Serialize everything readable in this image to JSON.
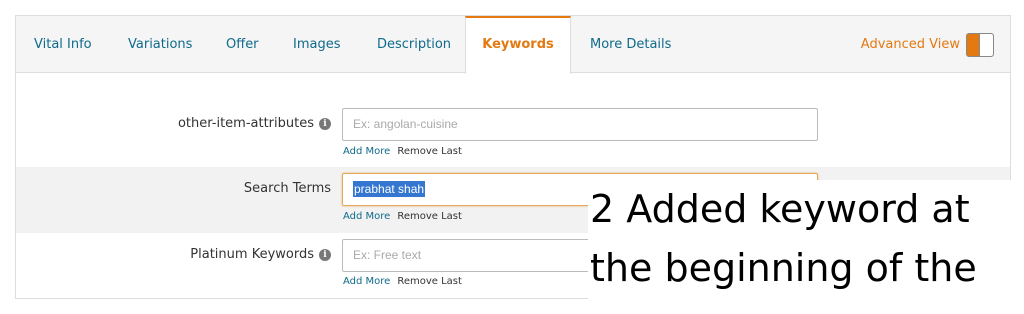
{
  "tabs": [
    {
      "label": "Vital Info"
    },
    {
      "label": "Variations"
    },
    {
      "label": "Offer"
    },
    {
      "label": "Images"
    },
    {
      "label": "Description"
    },
    {
      "label": "Keywords",
      "active": true
    },
    {
      "label": "More Details"
    }
  ],
  "advanced_view": {
    "label": "Advanced View",
    "enabled": true
  },
  "fields": [
    {
      "label": "other-item-attributes",
      "value": "",
      "placeholder": "Ex: angolan-cuisine",
      "add_more": "Add More",
      "remove_last": "Remove Last"
    },
    {
      "label": "Search Terms",
      "value": "prabhat shah",
      "placeholder": "",
      "add_more": "Add More",
      "remove_last": "Remove Last"
    },
    {
      "label": "Platinum Keywords",
      "value": "",
      "placeholder": "Ex: Free text",
      "add_more": "Add More",
      "remove_last": "Remove Last"
    }
  ],
  "annotation": {
    "line1": "2 Added keyword at",
    "line2": "the beginning of the"
  },
  "colors": {
    "accent": "#e47911",
    "link": "#0f6a8b",
    "selection": "#3476d0"
  }
}
